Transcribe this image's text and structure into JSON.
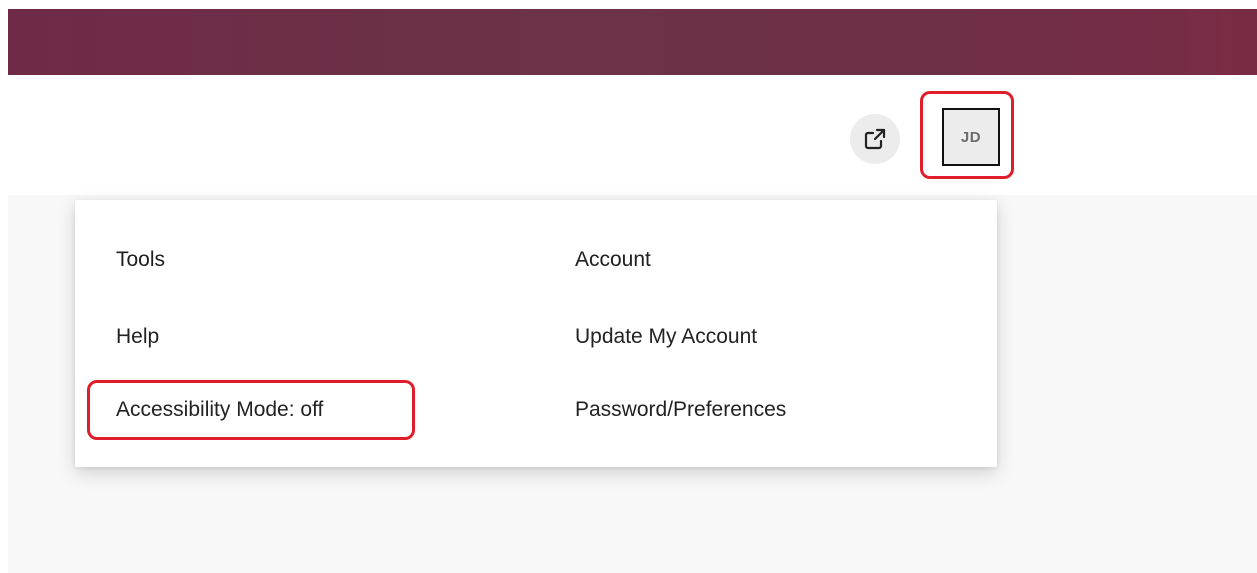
{
  "header": {
    "external_link_icon": "open-in-new-icon",
    "avatar_initials": "JD"
  },
  "menu": {
    "tools": {
      "heading": "Tools",
      "items": [
        {
          "label": "Help"
        },
        {
          "label": "Accessibility Mode: off"
        }
      ]
    },
    "account": {
      "heading": "Account",
      "items": [
        {
          "label": "Update My Account"
        },
        {
          "label": "Password/Preferences"
        }
      ]
    }
  },
  "colors": {
    "top_bar": "#6f2a47",
    "highlight": "#e01e2b"
  }
}
